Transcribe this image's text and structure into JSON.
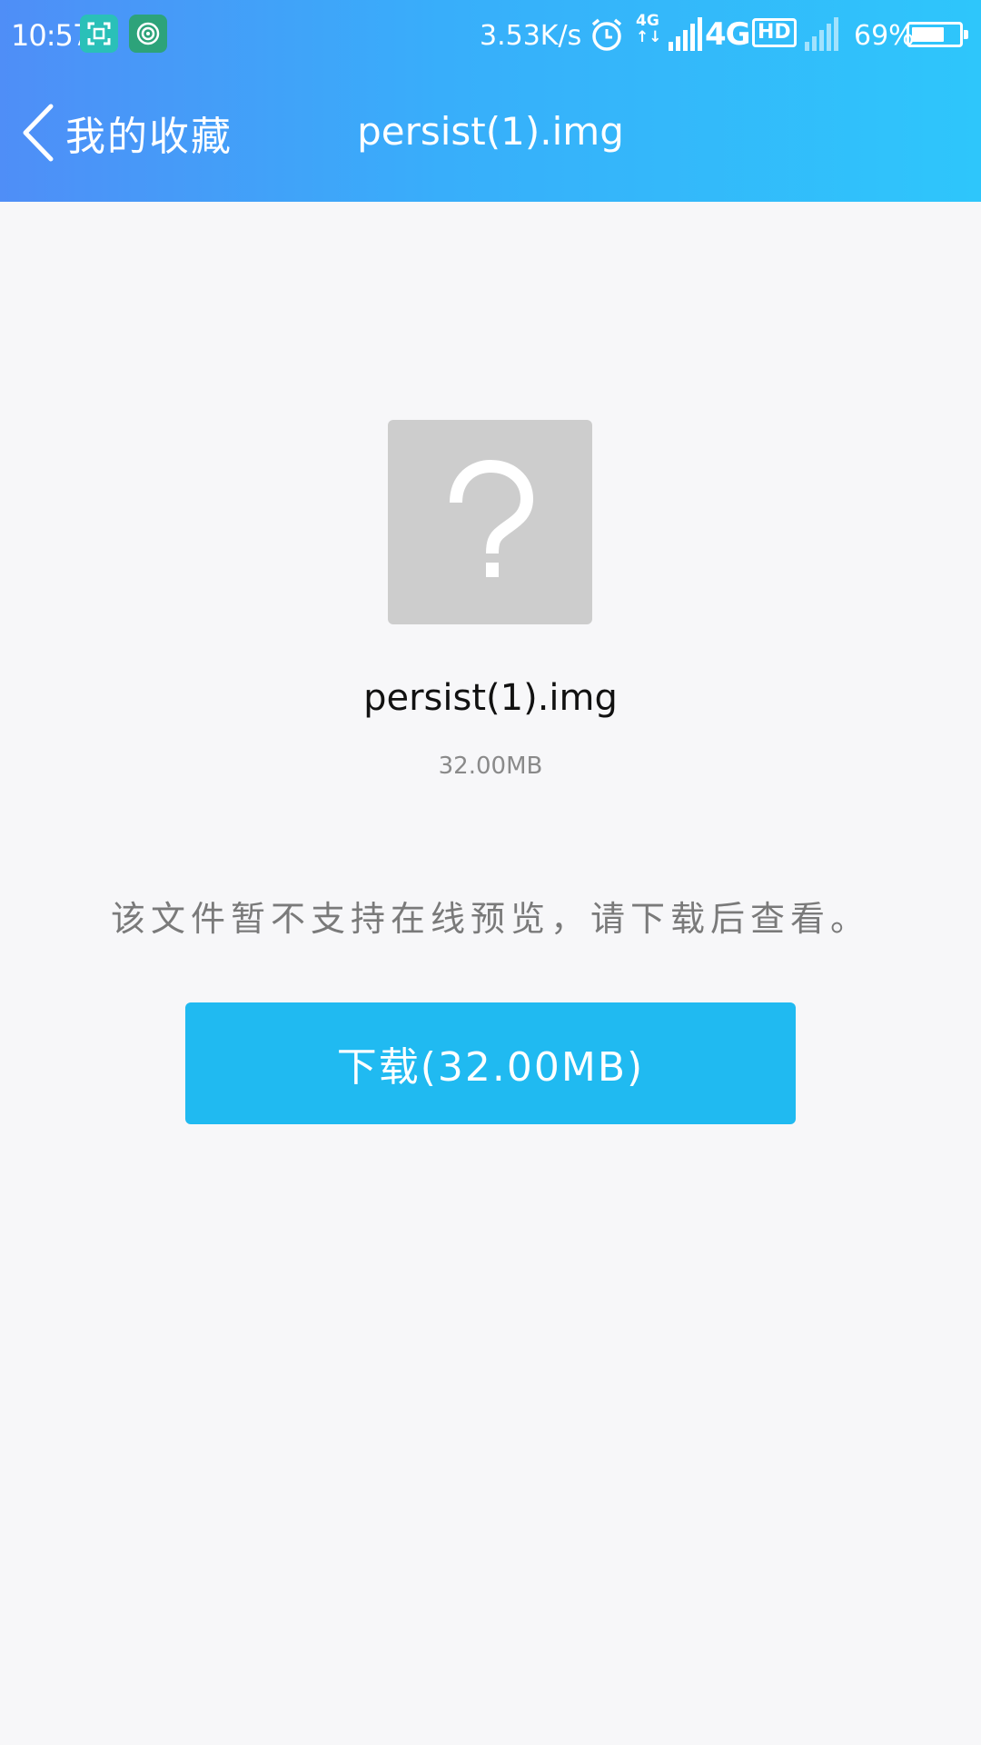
{
  "status_bar": {
    "time": "10:57",
    "network_speed": "3.53K/s",
    "network_type_small": "4G",
    "network_type": "4G",
    "hd_label": "HD",
    "battery_percent": "69%",
    "battery_level": 0.69,
    "icons": [
      "screenshot-scan-icon",
      "hotspot-icon",
      "alarm-icon",
      "signal-icon",
      "signal-icon"
    ]
  },
  "nav": {
    "back_label": "我的收藏",
    "title": "persist(1).img"
  },
  "file": {
    "icon": "unknown-file-icon",
    "name": "persist(1).img",
    "size": "32.00MB"
  },
  "notice": "该文件暂不支持在线预览，请下载后查看。",
  "download_button": {
    "label": "下载(32.00MB)"
  },
  "colors": {
    "header_start": "#4f8ef7",
    "header_end": "#2ec6fb",
    "button": "#20baf1",
    "background": "#f7f7f9",
    "file_icon_bg": "#cdcdcd"
  }
}
